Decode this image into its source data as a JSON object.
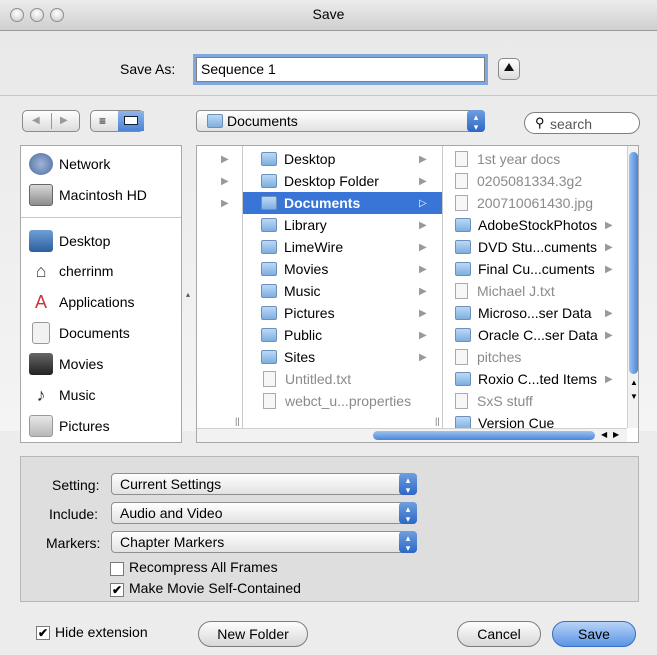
{
  "window": {
    "title": "Save"
  },
  "save_as": {
    "label": "Save As:",
    "value": "Sequence 1"
  },
  "toolbar": {
    "location": "Documents",
    "search_placeholder": "search"
  },
  "sidebar": {
    "items": [
      {
        "label": "Network",
        "icon": "network-icon"
      },
      {
        "label": "Macintosh HD",
        "icon": "hard-drive-icon"
      },
      {
        "label": "Desktop",
        "icon": "desktop-icon"
      },
      {
        "label": "cherrinm",
        "icon": "home-icon"
      },
      {
        "label": "Applications",
        "icon": "applications-icon"
      },
      {
        "label": "Documents",
        "icon": "documents-icon"
      },
      {
        "label": "Movies",
        "icon": "movies-icon"
      },
      {
        "label": "Music",
        "icon": "music-icon"
      },
      {
        "label": "Pictures",
        "icon": "pictures-icon"
      }
    ]
  },
  "columns": {
    "col2": [
      {
        "label": "Desktop"
      },
      {
        "label": "Desktop Folder"
      },
      {
        "label": "Documents"
      },
      {
        "label": "Library"
      },
      {
        "label": "LimeWire"
      },
      {
        "label": "Movies"
      },
      {
        "label": "Music"
      },
      {
        "label": "Pictures"
      },
      {
        "label": "Public"
      },
      {
        "label": "Sites"
      },
      {
        "label": "Untitled.txt"
      },
      {
        "label": "webct_u...properties"
      }
    ],
    "col3": [
      {
        "label": "1st year docs"
      },
      {
        "label": "0205081334.3g2"
      },
      {
        "label": "200710061430.jpg"
      },
      {
        "label": "AdobeStockPhotos"
      },
      {
        "label": "DVD Stu...cuments"
      },
      {
        "label": "Final Cu...cuments"
      },
      {
        "label": "Michael J.txt"
      },
      {
        "label": "Microso...ser Data"
      },
      {
        "label": "Oracle C...ser Data"
      },
      {
        "label": "pitches"
      },
      {
        "label": "Roxio C...ted Items"
      },
      {
        "label": "SxS stuff"
      },
      {
        "label": "Version Cue"
      }
    ]
  },
  "options": {
    "setting_label": "Setting:",
    "setting_value": "Current Settings",
    "include_label": "Include:",
    "include_value": "Audio and Video",
    "markers_label": "Markers:",
    "markers_value": "Chapter Markers",
    "recompress_label": "Recompress All Frames",
    "recompress_checked": false,
    "selfcontained_label": "Make Movie Self-Contained",
    "selfcontained_checked": true
  },
  "footer": {
    "hide_extension_label": "Hide extension",
    "hide_extension_checked": true,
    "new_folder_label": "New Folder",
    "cancel_label": "Cancel",
    "save_label": "Save"
  },
  "colors": {
    "selection": "#3875d7",
    "default_button": "#5b95e6",
    "focus_ring": "#7fa8dc"
  }
}
